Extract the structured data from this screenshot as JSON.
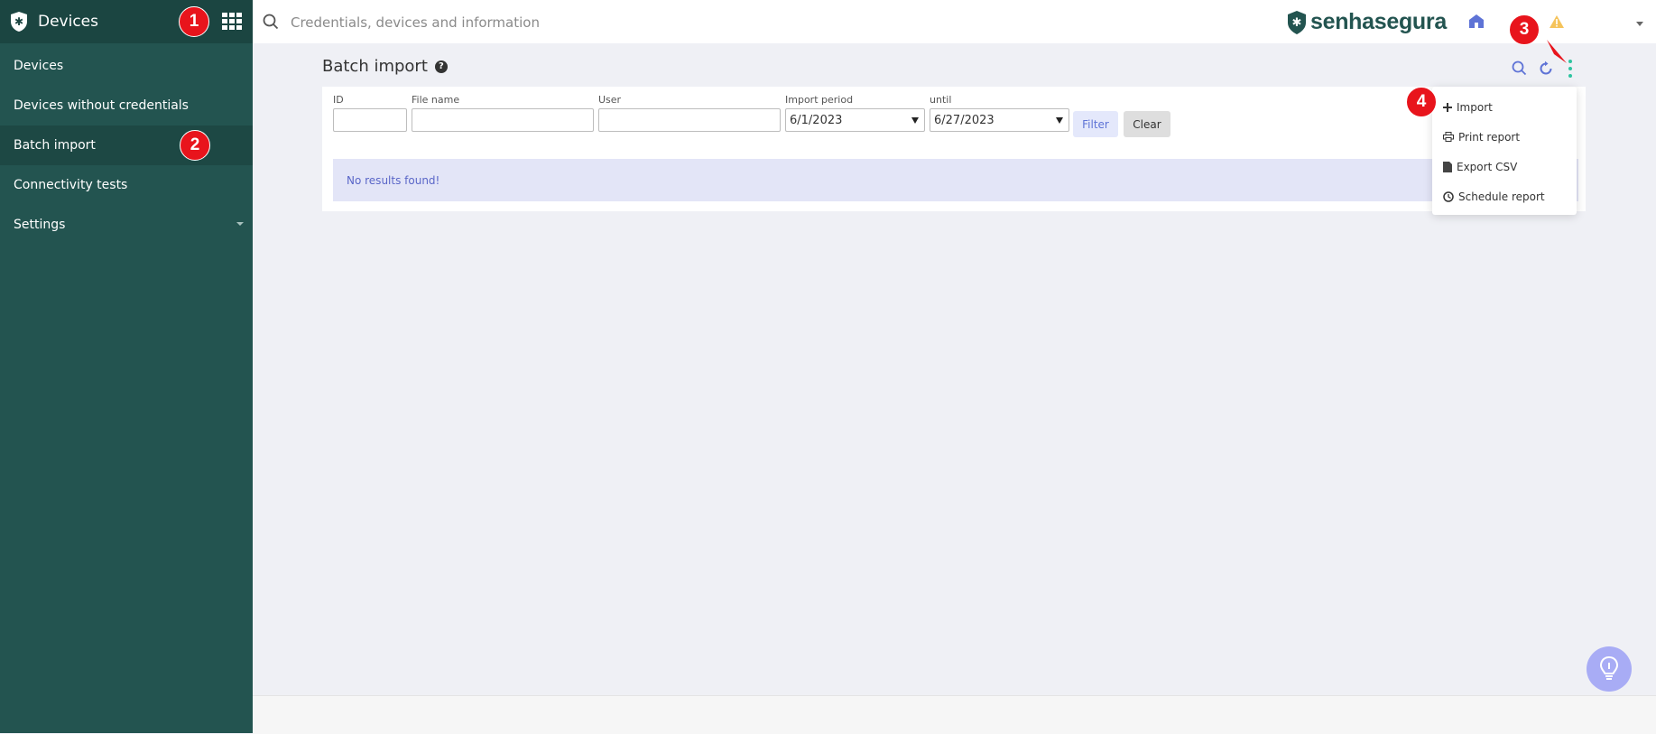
{
  "colors": {
    "sidebar": "#235450",
    "sidebar_header": "#1b4541",
    "accent": "#5e73d6",
    "kebab": "#2ec4a0",
    "marker": "#e8141c",
    "fab": "#a8acf5"
  },
  "sidebar": {
    "title": "Devices",
    "items": [
      {
        "label": "Devices"
      },
      {
        "label": "Devices without credentials"
      },
      {
        "label": "Batch import"
      },
      {
        "label": "Connectivity tests"
      },
      {
        "label": "Settings"
      }
    ]
  },
  "topbar": {
    "search_placeholder": "Credentials, devices and information",
    "brand": "senhasegura"
  },
  "page": {
    "title": "Batch import"
  },
  "filters": {
    "id_label": "ID",
    "id_value": "",
    "file_label": "File name",
    "file_value": "",
    "user_label": "User",
    "user_value": "",
    "period_label": "Import period",
    "period_from": "6/1/2023",
    "until_label": "until",
    "period_to": "6/27/2023",
    "filter_button": "Filter",
    "clear_button": "Clear"
  },
  "results": {
    "message": "No results found!"
  },
  "menu": {
    "import": "Import",
    "print": "Print report",
    "export": "Export CSV",
    "schedule": "Schedule report"
  },
  "markers": [
    "1",
    "2",
    "3",
    "4"
  ],
  "icons": {
    "app_grid": "grid-icon",
    "search": "search-icon",
    "home": "home-icon",
    "alert": "warning-icon",
    "refresh": "refresh-icon",
    "more": "kebab-icon",
    "help": "question-icon",
    "fab": "lightbulb-icon"
  }
}
